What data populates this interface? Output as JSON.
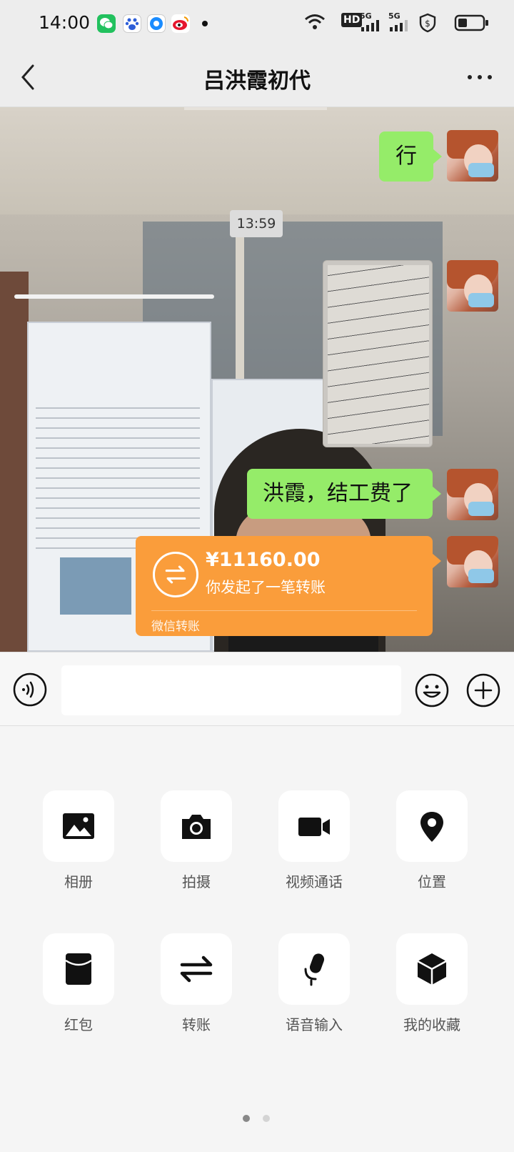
{
  "status_bar": {
    "time": "14:00",
    "network_badge": "HD",
    "signal_1": "5G",
    "signal_2": "5G"
  },
  "header": {
    "title": "吕洪霞初代"
  },
  "chat": {
    "timestamp": "13:59",
    "messages": [
      {
        "type": "text",
        "text": "行"
      },
      {
        "type": "image"
      },
      {
        "type": "text",
        "text": "洪霞，结工费了"
      },
      {
        "type": "transfer",
        "amount": "¥11160.00",
        "description": "你发起了一笔转账",
        "footer": "微信转账"
      }
    ]
  },
  "input": {
    "placeholder": ""
  },
  "more_panel": {
    "items": [
      {
        "label": "相册",
        "icon": "album-icon"
      },
      {
        "label": "拍摄",
        "icon": "camera-icon"
      },
      {
        "label": "视频通话",
        "icon": "video-call-icon"
      },
      {
        "label": "位置",
        "icon": "location-icon"
      },
      {
        "label": "红包",
        "icon": "red-packet-icon"
      },
      {
        "label": "转账",
        "icon": "transfer-icon"
      },
      {
        "label": "语音输入",
        "icon": "voice-input-icon"
      },
      {
        "label": "我的收藏",
        "icon": "favorites-icon"
      }
    ],
    "page_count": 2,
    "current_page": 1
  },
  "colors": {
    "bubble_green": "#95ec69",
    "transfer_orange": "#fa9d3b",
    "page_bg": "#ededed"
  }
}
